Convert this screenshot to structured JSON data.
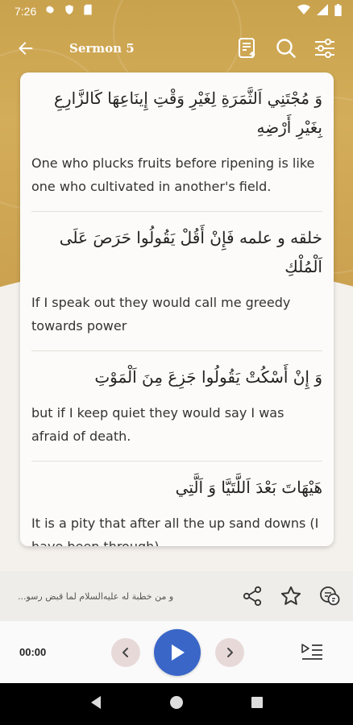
{
  "status_bar": {
    "time": "7:26",
    "left_icons": [
      "settings-icon",
      "shield-icon",
      "sd-card-icon"
    ],
    "right_icons": [
      "wifi-icon",
      "signal-icon",
      "battery-icon"
    ]
  },
  "app_bar": {
    "title": "Sermon 5",
    "actions": [
      "translate-icon",
      "search-icon",
      "settings-sliders-icon"
    ]
  },
  "verses": [
    {
      "arabic": "وَ مُجْتَنِي اَلثَّمَرَةِ لِغَيْرِ وَقْتِ إِينَاعِهَا كَالزَّارِعِ بِغَيْرِ أَرْضِهِ",
      "english": "One who plucks fruits before ripening is like one who cultivated in another's field."
    },
    {
      "arabic": "خلقه و علمه فَإِنْ أَقُلْ يَقُولُوا حَرَصَ عَلَى اَلْمُلْكِ",
      "english": "If I speak out they would call me greedy towards power"
    },
    {
      "arabic": "وَ إِنْ أَسْكُتْ يَقُولُوا جَزِعَ مِنَ اَلْمَوْتِ",
      "english": "but if I keep quiet they would say I was afraid of death."
    },
    {
      "arabic": "هَيْهَاتَ بَعْدَ اَللَّتَيَّا وَ اَلَّتِي",
      "english": "It is a pity that after all the up sand downs (I have been through)."
    }
  ],
  "action_strip": {
    "sermon_name": "و من خطبة له عليه‌السلام لما قبض رسو...",
    "actions": [
      "share-icon",
      "star-icon",
      "chat-bubbles-icon"
    ]
  },
  "player": {
    "time": "00:00"
  },
  "colors": {
    "gold": "#c9a24d",
    "play_button": "#3a66c8",
    "skip_button": "#e8d9d9"
  }
}
